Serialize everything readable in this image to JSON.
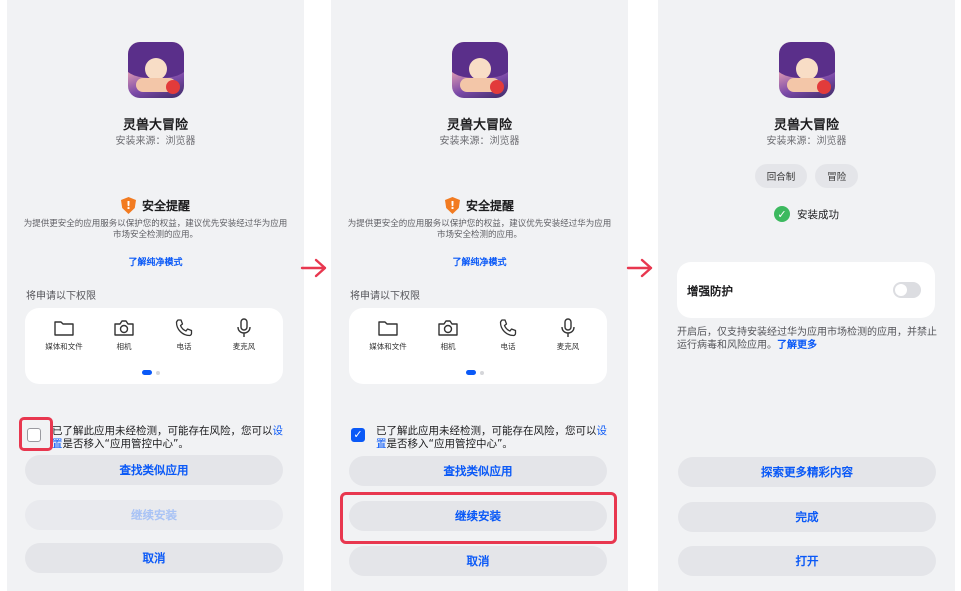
{
  "app": {
    "name": "灵兽大冒险",
    "source": "安装来源：浏览器"
  },
  "warning": {
    "title": "安全提醒",
    "desc": "为提供更安全的应用服务以保护您的权益，建议优先安装经过华为应用市场安全检测的应用。",
    "link": "了解纯净模式"
  },
  "permissions": {
    "title": "将申请以下权限",
    "items": [
      {
        "label": "媒体和文件",
        "icon": "folder-icon"
      },
      {
        "label": "相机",
        "icon": "camera-icon"
      },
      {
        "label": "电话",
        "icon": "phone-icon"
      },
      {
        "label": "麦克风",
        "icon": "microphone-icon"
      }
    ]
  },
  "consent": {
    "text_before": "已了解此应用未经检测，可能存在风险，您可以",
    "link": "设置",
    "text_after": "是否移入“应用管控中心”。"
  },
  "buttons": {
    "find_similar": "查找类似应用",
    "continue_install": "继续安装",
    "cancel": "取消"
  },
  "screen1": {
    "checked": false
  },
  "screen2": {
    "checked": true
  },
  "screen3": {
    "tags": [
      "回合制",
      "冒险"
    ],
    "success": "安装成功",
    "protect_label": "增强防护",
    "protect_on": false,
    "protect_desc": "开启后，仅支持安装经过华为应用市场检测的应用，并禁止运行病毒和风险应用。",
    "protect_link": "了解更多",
    "explore": "探索更多精彩内容",
    "done": "完成",
    "open": "打开"
  },
  "colors": {
    "accent": "#0a59f7",
    "highlight": "#e8374f",
    "warning": "#f27b21",
    "success": "#3cb95f"
  }
}
